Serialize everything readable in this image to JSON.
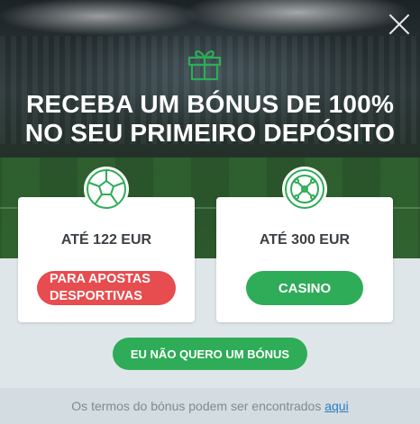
{
  "headline": {
    "line1": "RECEBA UM BÓNUS DE 100%",
    "line2": "NO SEU PRIMEIRO DEPÓSITO"
  },
  "cards": {
    "sport": {
      "amount": "ATÉ 122 EUR",
      "button_line1": "PARA APOSTAS",
      "button_line2": "DESPORTIVAS",
      "icon": "football-icon"
    },
    "casino": {
      "amount": "ATÉ 300 EUR",
      "button_label": "CASINO",
      "icon": "roulette-icon"
    }
  },
  "no_bonus_label": "EU NÃO QUERO UM BÓNUS",
  "footer": {
    "text": "Os termos do bónus podem ser encontrados",
    "link_label": "aqui"
  },
  "colors": {
    "green": "#2eac57",
    "red": "#e74c4f",
    "link": "#2a7dc0"
  }
}
